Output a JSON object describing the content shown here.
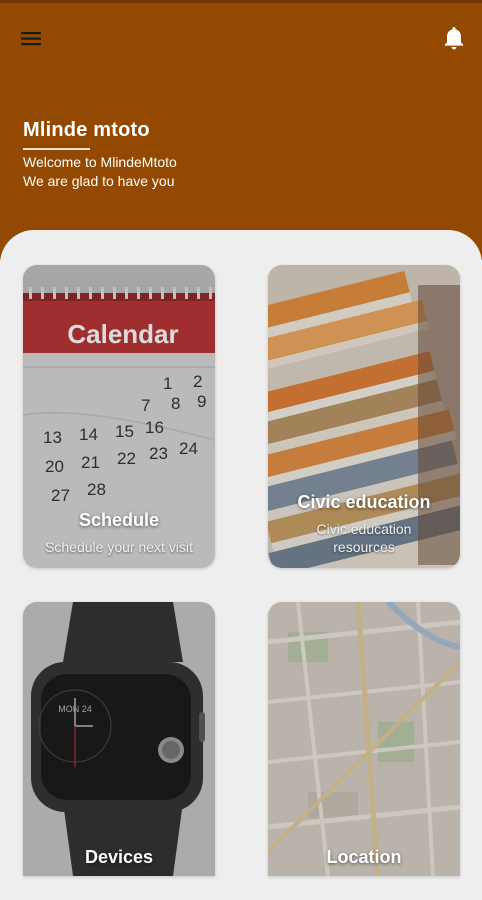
{
  "app": {
    "title": "Mlinde mtoto",
    "welcome": "Welcome to MlindeMtoto",
    "subtitle": "We are glad to have you"
  },
  "icons": {
    "menu": "menu-icon",
    "notification": "bell-icon"
  },
  "colors": {
    "header_bg": "#944902",
    "content_bg": "#eeeeee",
    "card_text": "#ffffff"
  },
  "cards": {
    "schedule": {
      "title": "Schedule",
      "subtitle": "Schedule your next visit",
      "image_text": "Calendar",
      "calendar_days": [
        "13",
        "14",
        "15",
        "16",
        "20",
        "21",
        "22",
        "23",
        "24",
        "27",
        "28",
        "1",
        "2",
        "7",
        "8",
        "9"
      ]
    },
    "civic": {
      "title": "Civic education",
      "subtitle": "Civic education resources"
    },
    "devices": {
      "title": "Devices",
      "watch_text": "MON 24"
    },
    "location": {
      "title": "Location"
    }
  }
}
